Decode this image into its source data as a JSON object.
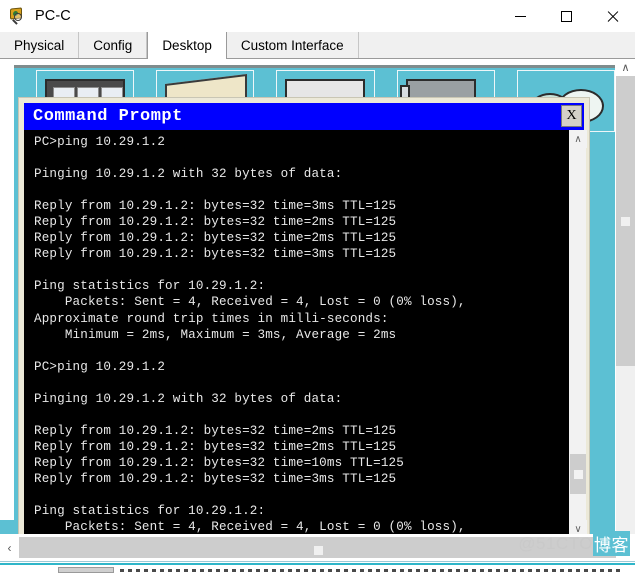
{
  "window": {
    "title": "PC-C",
    "icon": "pc-globe-magnifier-icon",
    "minimize_label": "—",
    "maximize_label": "□",
    "close_label": "✕"
  },
  "tabs": [
    {
      "label": "Physical",
      "active": false
    },
    {
      "label": "Config",
      "active": false
    },
    {
      "label": "Desktop",
      "active": true
    },
    {
      "label": "Custom Interface",
      "active": false
    }
  ],
  "desktop": {
    "background_color": "#5cc0d3",
    "icons": [
      {
        "name": "panes-icon"
      },
      {
        "name": "papers-icon"
      },
      {
        "name": "plain-window-icon"
      },
      {
        "name": "monitor-icon"
      },
      {
        "name": "cloud-icon"
      }
    ]
  },
  "command_prompt": {
    "title": "Command Prompt",
    "title_bar_color": "#0000ff",
    "close_label": "X",
    "terminal_bg": "#000000",
    "terminal_fg": "#e8e8e8",
    "lines": [
      "PC>ping 10.29.1.2",
      "",
      "Pinging 10.29.1.2 with 32 bytes of data:",
      "",
      "Reply from 10.29.1.2: bytes=32 time=3ms TTL=125",
      "Reply from 10.29.1.2: bytes=32 time=2ms TTL=125",
      "Reply from 10.29.1.2: bytes=32 time=2ms TTL=125",
      "Reply from 10.29.1.2: bytes=32 time=3ms TTL=125",
      "",
      "Ping statistics for 10.29.1.2:",
      "    Packets: Sent = 4, Received = 4, Lost = 0 (0% loss),",
      "Approximate round trip times in milli-seconds:",
      "    Minimum = 2ms, Maximum = 3ms, Average = 2ms",
      "",
      "PC>ping 10.29.1.2",
      "",
      "Pinging 10.29.1.2 with 32 bytes of data:",
      "",
      "Reply from 10.29.1.2: bytes=32 time=2ms TTL=125",
      "Reply from 10.29.1.2: bytes=32 time=2ms TTL=125",
      "Reply from 10.29.1.2: bytes=32 time=10ms TTL=125",
      "Reply from 10.29.1.2: bytes=32 time=3ms TTL=125",
      "",
      "Ping statistics for 10.29.1.2:",
      "    Packets: Sent = 4, Received = 4, Lost = 0 (0% loss),"
    ],
    "scrollbar": {
      "up_arrow": "∧",
      "down_arrow": "∨"
    }
  },
  "page_scrollbars": {
    "vertical": {
      "up_arrow": "∧",
      "down_arrow": "∨"
    },
    "horizontal": {
      "left_arrow": "‹"
    }
  },
  "watermark": {
    "text": "@51CTO",
    "tail": "博客"
  }
}
